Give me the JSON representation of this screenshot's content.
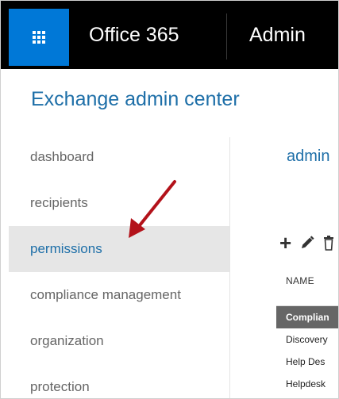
{
  "colors": {
    "accent": "#1e6fa8",
    "launcher_bg": "#0078d7",
    "topbar_bg": "#000000",
    "selected_row_bg": "#666666",
    "annotation_arrow": "#b3121a"
  },
  "topbar": {
    "launcher_icon": "app-launcher-waffle-icon",
    "brand": "Office 365",
    "section": "Admin"
  },
  "app": {
    "title": "Exchange admin center"
  },
  "nav": {
    "items": [
      {
        "label": "dashboard"
      },
      {
        "label": "recipients"
      },
      {
        "label": "permissions",
        "active": true
      },
      {
        "label": "compliance management"
      },
      {
        "label": "organization"
      },
      {
        "label": "protection"
      }
    ]
  },
  "main": {
    "heading": "admin",
    "toolbar": {
      "icons": [
        "add-icon",
        "edit-icon",
        "delete-icon"
      ]
    },
    "table": {
      "columns": [
        "NAME"
      ],
      "rows": [
        "Complian",
        "Discovery",
        "Help Des",
        "Helpdesk"
      ],
      "selected_index": 0
    }
  }
}
